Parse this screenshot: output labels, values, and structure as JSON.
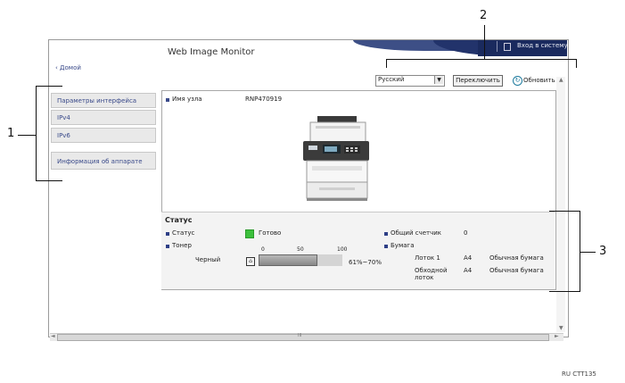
{
  "header": {
    "title": "Web Image Monitor",
    "login_label": "Вход в систему"
  },
  "nav": {
    "home_label": "Домой"
  },
  "toolbar": {
    "language_value": "Русский",
    "switch_label": "Переключить",
    "refresh_label": "Обновить"
  },
  "sidebar": {
    "items": [
      {
        "label": "Параметры интерфейса"
      },
      {
        "label": "IPv4"
      },
      {
        "label": "IPv6"
      },
      {
        "label": "Информация об аппарате"
      }
    ]
  },
  "device": {
    "host_label": "Имя узла",
    "host_value": "RNP470919"
  },
  "status": {
    "title": "Статус",
    "status_label": "Статус",
    "status_value": "Готово",
    "toner_label": "Тонер",
    "toner_color": "Черный",
    "toner_scale": [
      "0",
      "50",
      "100"
    ],
    "toner_level_fraction": 0.7,
    "toner_range": "61%~70%",
    "counter_label": "Общий счетчик",
    "counter_value": "0",
    "paper_label": "Бумага",
    "trays": [
      {
        "name": "Лоток 1",
        "size": "A4",
        "type": "Обычная бумага"
      },
      {
        "name": "Обходной лоток",
        "size": "A4",
        "type": "Обычная бумага"
      }
    ]
  },
  "callouts": {
    "c1": "1",
    "c2": "2",
    "c3": "3"
  },
  "figure_code": "RU CTT135",
  "colors": {
    "header_navy": "#22336b",
    "link_blue": "#3a4a8a",
    "ready_green": "#3cc03c"
  }
}
